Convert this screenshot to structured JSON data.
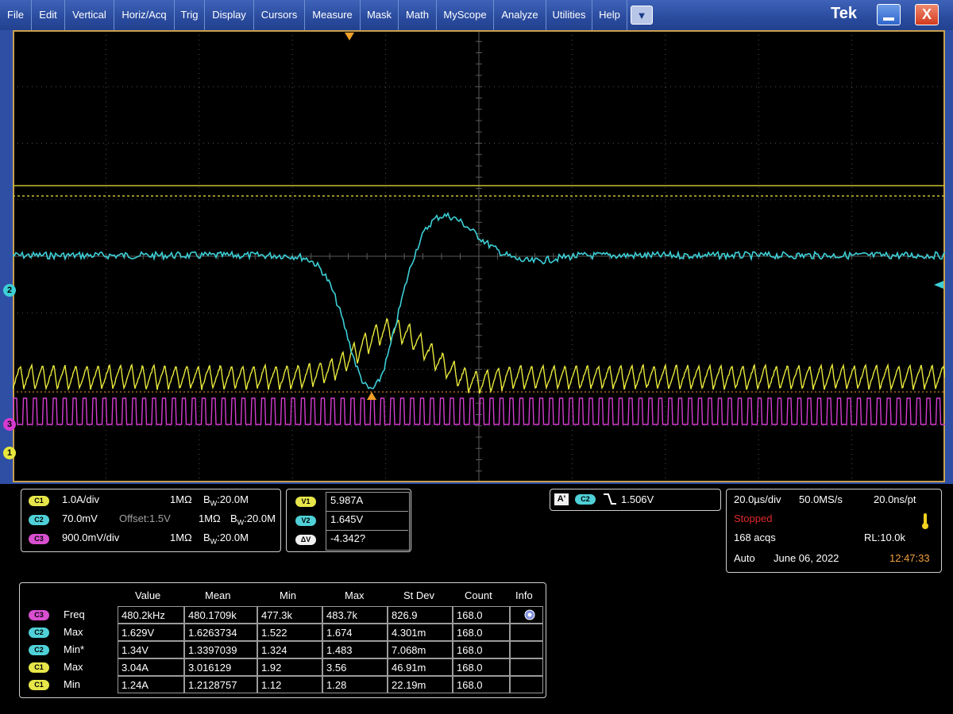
{
  "menu": [
    "File",
    "Edit",
    "Vertical",
    "Horiz/Acq",
    "Trig",
    "Display",
    "Cursors",
    "Measure",
    "Mask",
    "Math",
    "MyScope",
    "Analyze",
    "Utilities",
    "Help"
  ],
  "brand": "Tek",
  "dropdown_glyph": "▼",
  "close_glyph": "X",
  "icons": {
    "dropdown": "chevron-down-icon",
    "minimize": "minimize-icon",
    "close": "close-icon"
  },
  "colors": {
    "ch1": "#e8e83c",
    "ch2": "#3ccfd6",
    "ch3": "#d43cd0",
    "trigger": "#f0a028",
    "grid": "#5a5a5a",
    "cursor": "#c8c032"
  },
  "markers": {
    "ch1": "1",
    "ch2": "2",
    "ch3": "3"
  },
  "channels": [
    {
      "badge": "C1",
      "scale": "1.0A/div",
      "offset": "",
      "impedance": "1MΩ",
      "bw_prefix": "B",
      "bw_sub": "W",
      "bw": ":20.0M"
    },
    {
      "badge": "C2",
      "scale": "70.0mV",
      "offset": "Offset:1.5V",
      "impedance": "1MΩ",
      "bw_prefix": "B",
      "bw_sub": "W",
      "bw": ":20.0M"
    },
    {
      "badge": "C3",
      "scale": "900.0mV/div",
      "offset": "",
      "impedance": "1MΩ",
      "bw_prefix": "B",
      "bw_sub": "W",
      "bw": ":20.0M"
    }
  ],
  "cursors": [
    {
      "badge": "V1",
      "value": "5.987A"
    },
    {
      "badge": "V2",
      "value": "1.645V"
    },
    {
      "badge": "ΔV",
      "value": "-4.342?"
    }
  ],
  "trigger": {
    "badge_a": "A'",
    "badge_c": "C2",
    "level": "1.506V"
  },
  "acquisition": {
    "horizontal": "20.0µs/div",
    "sample_rate": "50.0MS/s",
    "resolution": "20.0ns/pt",
    "state": "Stopped",
    "acqs": "168 acqs",
    "record_length": "RL:10.0k",
    "mode": "Auto",
    "date": "June 06, 2022",
    "time": "12:47:33"
  },
  "measurements": {
    "headers": [
      "Value",
      "Mean",
      "Min",
      "Max",
      "St Dev",
      "Count",
      "Info"
    ],
    "rows": [
      {
        "badge": "C3",
        "name": "Freq",
        "value": "480.2kHz",
        "mean": "480.1709k",
        "min": "477.3k",
        "max": "483.7k",
        "stdev": "826.9",
        "count": "168.0"
      },
      {
        "badge": "C2",
        "name": "Max",
        "value": "1.629V",
        "mean": "1.6263734",
        "min": "1.522",
        "max": "1.674",
        "stdev": "4.301m",
        "count": "168.0"
      },
      {
        "badge": "C2",
        "name": "Min*",
        "value": "1.34V",
        "mean": "1.3397039",
        "min": "1.324",
        "max": "1.483",
        "stdev": "7.068m",
        "count": "168.0"
      },
      {
        "badge": "C1",
        "name": "Max",
        "value": "3.04A",
        "mean": "3.016129",
        "min": "1.92",
        "max": "3.56",
        "stdev": "46.91m",
        "count": "168.0"
      },
      {
        "badge": "C1",
        "name": "Min",
        "value": "1.24A",
        "mean": "1.2128757",
        "min": "1.12",
        "max": "1.28",
        "stdev": "22.19m",
        "count": "168.0"
      }
    ]
  }
}
